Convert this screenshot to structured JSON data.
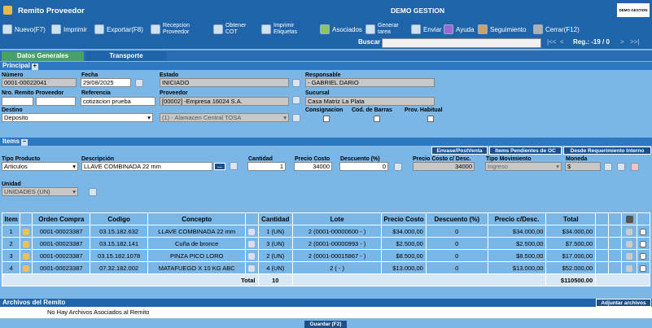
{
  "title": "Remito Proveedor",
  "company": "DEMO GESTION",
  "logo_text": "DEMO GESTION",
  "toolbar": {
    "nuevo": "Nuevo(F7)",
    "imprimir": "Imprimir",
    "exportar": "Exportar(F8)",
    "recepcion_1": "Recepcion",
    "recepcion_2": "Proveedor",
    "obtener_1": "Obtener",
    "obtener_2": "COT",
    "etiquetas_1": "Imprimir",
    "etiquetas_2": "Etiquetas",
    "asociados": "Asociados",
    "tarea_1": "Generar",
    "tarea_2": "tarea",
    "enviar": "Enviar",
    "ayuda": "Ayuda",
    "seguimiento": "Seguimiento",
    "cerrar": "Cerrar(F12)"
  },
  "search": {
    "label": "Buscar",
    "value": "",
    "first": "|<<",
    "prev": "<",
    "next": ">",
    "last": ">>|",
    "reg": "Reg.: -19 / 0"
  },
  "tabs": {
    "general": "Datos Generales",
    "transporte": "Transporte"
  },
  "principal": {
    "section": "Principal",
    "numero_label": "Número",
    "numero": "0001-00022041",
    "fecha_label": "Fecha",
    "fecha": "29/08/2025",
    "estado_label": "Estado",
    "estado": "INICIADO",
    "responsable_label": "Responsable",
    "responsable": "- GABRIEL DARIO",
    "remito_prov_label": "Nro. Remito Proveedor",
    "remito_prov_a": "",
    "remito_prov_b": "",
    "referencia_label": "Referencia",
    "referencia": "cotizacion prueba",
    "proveedor_label": "Proveedor",
    "proveedor": "[00002] -Empresa 16024 S.A.",
    "sucursal_label": "Sucursal",
    "sucursal": "Casa Matriz La Plata",
    "destino_label": "Destino",
    "destino": "Deposito",
    "almacen": "(1) - Alamacen Central TOSA",
    "consignacion_label": "Consignacion",
    "codbarras_label": "Cod. de Barras",
    "prov_habitual_label": "Prov. Habitual"
  },
  "items": {
    "section": "Items",
    "btn_envase": "Envase/PostVenta",
    "btn_pendientes": "Items Pendientes de OC",
    "btn_desde": "Desde Requerimiento Interno",
    "tipo_producto_label": "Tipo Producto",
    "tipo_producto": "Articulos",
    "descripcion_label": "Descripción",
    "descripcion": "LLAVE COMBINADA 22 mm",
    "desc_btn": "...",
    "cantidad_label": "Cantidad",
    "cantidad": "1",
    "precio_costo_label": "Precio Costo",
    "precio_costo": "34000",
    "descuento_label": "Descuento (%)",
    "descuento": "0",
    "precio_desc_label": "Precio Costo c/ Desc.",
    "precio_desc": "34000",
    "tipo_mov_label": "Tipo Movimiento",
    "tipo_mov": "Ingreso",
    "moneda_label": "Moneda",
    "moneda": "$",
    "unidad_label": "Unidad",
    "unidad": "UNIDADES (UN)"
  },
  "table": {
    "headers": [
      "Item",
      "Orden Compra",
      "Codigo",
      "Concepto",
      "Cantidad",
      "Lote",
      "Precio Costo",
      "Descuento (%)",
      "Precio c/Desc.",
      "Total"
    ],
    "rows": [
      {
        "item": "1",
        "oc": "0001-00023387",
        "codigo": "03.15.182.632",
        "concepto": "LLAVE COMBINADA 22 mm",
        "cantidad": "1 (UN)",
        "lote": "2 (0001-00000600 - )",
        "precio": "$34.000,00",
        "desc": "0",
        "pdesc": "$34.000,00",
        "total": "$34.000,00"
      },
      {
        "item": "2",
        "oc": "0001-00023387",
        "codigo": "03.15.182.141",
        "concepto": "Cuña de bronce",
        "cantidad": "3 (UN)",
        "lote": "2 (0001-00000993 - )",
        "precio": "$2.500,00",
        "desc": "0",
        "pdesc": "$2.500,00",
        "total": "$7.500,00"
      },
      {
        "item": "3",
        "oc": "0001-00023387",
        "codigo": "03.15.182.1078",
        "concepto": "PINZA PICO LORO",
        "cantidad": "2 (UN)",
        "lote": "2 (0001-00015867 - )",
        "precio": "$8.500,00",
        "desc": "0",
        "pdesc": "$8.500,00",
        "total": "$17.000,00"
      },
      {
        "item": "4",
        "oc": "0001-00023387",
        "codigo": "07.32.182.002",
        "concepto": "MATAFUEGO X 10 KG ABC",
        "cantidad": "4 (UN)",
        "lote": "2 ( - )",
        "precio": "$13.000,00",
        "desc": "0",
        "pdesc": "$13.000,00",
        "total": "$52.000,00"
      }
    ],
    "total_label": "Total",
    "total_qty": "10",
    "grand_total": "$110500.00"
  },
  "files": {
    "section": "Archivos del Remito",
    "adjuntar": "Adjuntar archivos",
    "empty": "No Hay Archivos Asociados al Remito"
  },
  "guardar": "Guardar (F2)"
}
